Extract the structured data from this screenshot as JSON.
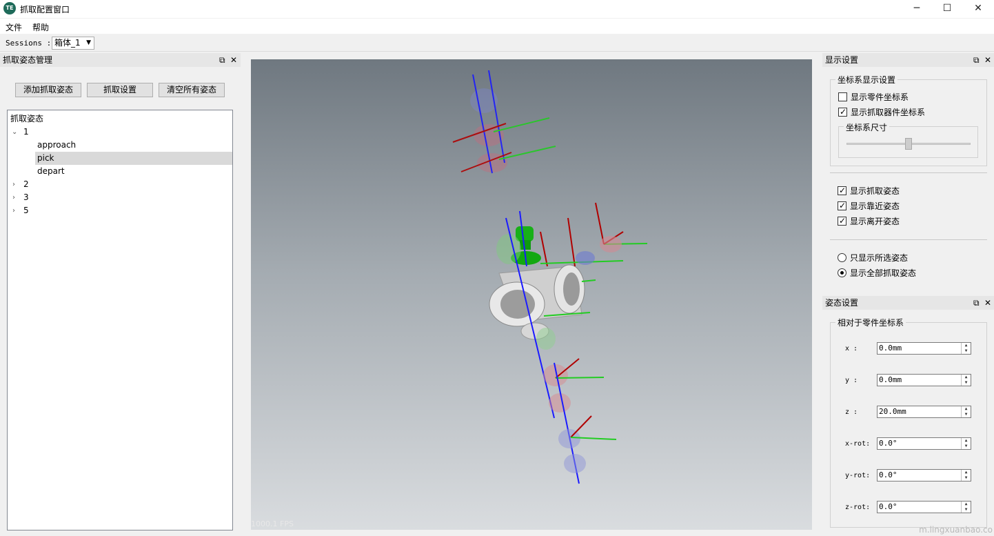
{
  "window": {
    "title": "抓取配置窗口",
    "logo_text": "TE"
  },
  "menu": {
    "file": "文件",
    "help": "帮助"
  },
  "toolbar": {
    "sessions_label": "Sessions :",
    "session_value": "箱体_1"
  },
  "left_dock": {
    "title": "抓取姿态管理",
    "buttons": {
      "add": "添加抓取姿态",
      "settings": "抓取设置",
      "clear": "清空所有姿态"
    },
    "tree": {
      "header": "抓取姿态",
      "root1": "1",
      "children": [
        "approach",
        "pick",
        "depart"
      ],
      "others": [
        "2",
        "3",
        "5"
      ]
    }
  },
  "viewport": {
    "fps": "1000.1 FPS"
  },
  "display_dock": {
    "title": "显示设置",
    "coord_group": "坐标系显示设置",
    "show_part_frame": "显示零件坐标系",
    "show_gripper_frame": "显示抓取器件坐标系",
    "frame_size_group": "坐标系尺寸",
    "frame_size_level": 0.5,
    "show_pick": "显示抓取姿态",
    "show_approach": "显示靠近姿态",
    "show_depart": "显示离开姿态",
    "only_selected": "只显示所选姿态",
    "show_all": "显示全部抓取姿态"
  },
  "pose_dock": {
    "title": "姿态设置",
    "group": "相对于零件坐标系",
    "fields": [
      {
        "label": "x :",
        "value": "0.0mm"
      },
      {
        "label": "y :",
        "value": "0.0mm"
      },
      {
        "label": "z :",
        "value": "20.0mm"
      },
      {
        "label": "x-rot:",
        "value": "0.0°"
      },
      {
        "label": "y-rot:",
        "value": "0.0°"
      },
      {
        "label": "z-rot:",
        "value": "0.0°"
      }
    ]
  },
  "watermark": "m.lingxuanbao.co"
}
